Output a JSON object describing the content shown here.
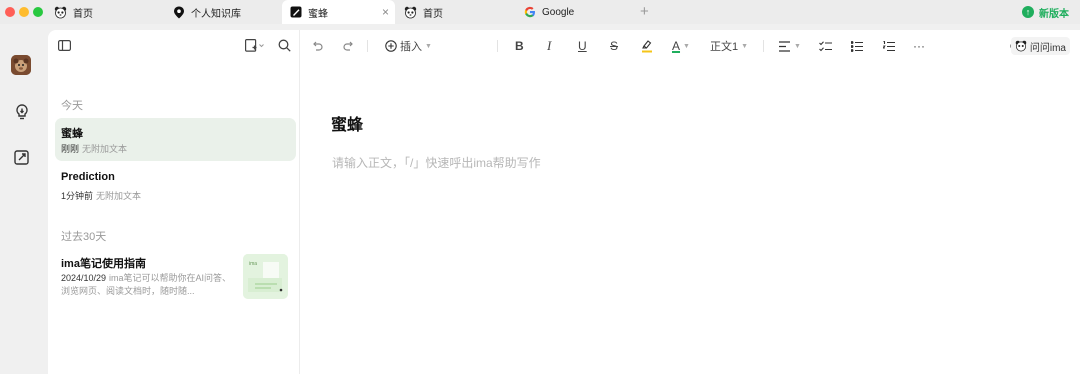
{
  "tabs": [
    {
      "label": "首页",
      "icon": "panda-icon"
    },
    {
      "label": "个人知识库",
      "icon": "location-pin-icon"
    },
    {
      "label": "蜜蜂",
      "icon": "note-icon",
      "active": true
    },
    {
      "label": "首页",
      "icon": "panda-icon"
    },
    {
      "label": "Google",
      "icon": "google-icon"
    }
  ],
  "tab_close": "×",
  "tab_add": "+",
  "new_version": "新版本",
  "colors": {
    "accent": "#1fae5d",
    "selected_bg": "#eaf1ea"
  },
  "sidebar": {
    "sections": [
      {
        "label": "今天",
        "notes": [
          {
            "title": "蜜蜂",
            "time": "刚刚",
            "meta": "无附加文本",
            "selected": true
          },
          {
            "title": "Prediction",
            "time": "1分钟前",
            "meta": "无附加文本"
          }
        ]
      },
      {
        "label": "过去30天",
        "notes": [
          {
            "title": "ima笔记使用指南",
            "time": "2024/10/29",
            "meta": "ima笔记可以帮助你在AI问答、浏览网页、阅读文档时，随时随...",
            "thumb_label": "ima"
          }
        ]
      }
    ]
  },
  "toolbar": {
    "insert": "插入",
    "bold": "B",
    "italic": "I",
    "underline": "U",
    "strike": "S",
    "font_color": "A",
    "paragraph": "正文1",
    "more": "···",
    "ask": "问问ima"
  },
  "editor": {
    "title": "蜜蜂",
    "placeholder": "请输入正文，「/」快速呼出ima帮助写作"
  }
}
